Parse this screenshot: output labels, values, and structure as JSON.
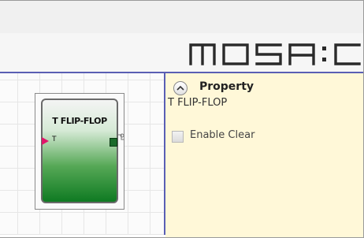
{
  "app": {
    "logo_text": "MOSAIC"
  },
  "canvas": {
    "block": {
      "title": "T FLIP-FLOP",
      "input_pin_label": "T"
    }
  },
  "property_panel": {
    "title": "Property",
    "block_name": "T FLIP-FLOP",
    "options": [
      {
        "label": "Enable Clear",
        "checked": false
      }
    ]
  },
  "colors": {
    "canvas_border": "#5a5fb4",
    "panel_background": "#fff8d8",
    "block_green": "#0f7a22",
    "input_pin": "#e0156a",
    "output_pin": "#1a6a2a"
  },
  "icons": [
    "collapse-up-icon",
    "input-pin-arrow-icon",
    "output-pin-icon"
  ]
}
